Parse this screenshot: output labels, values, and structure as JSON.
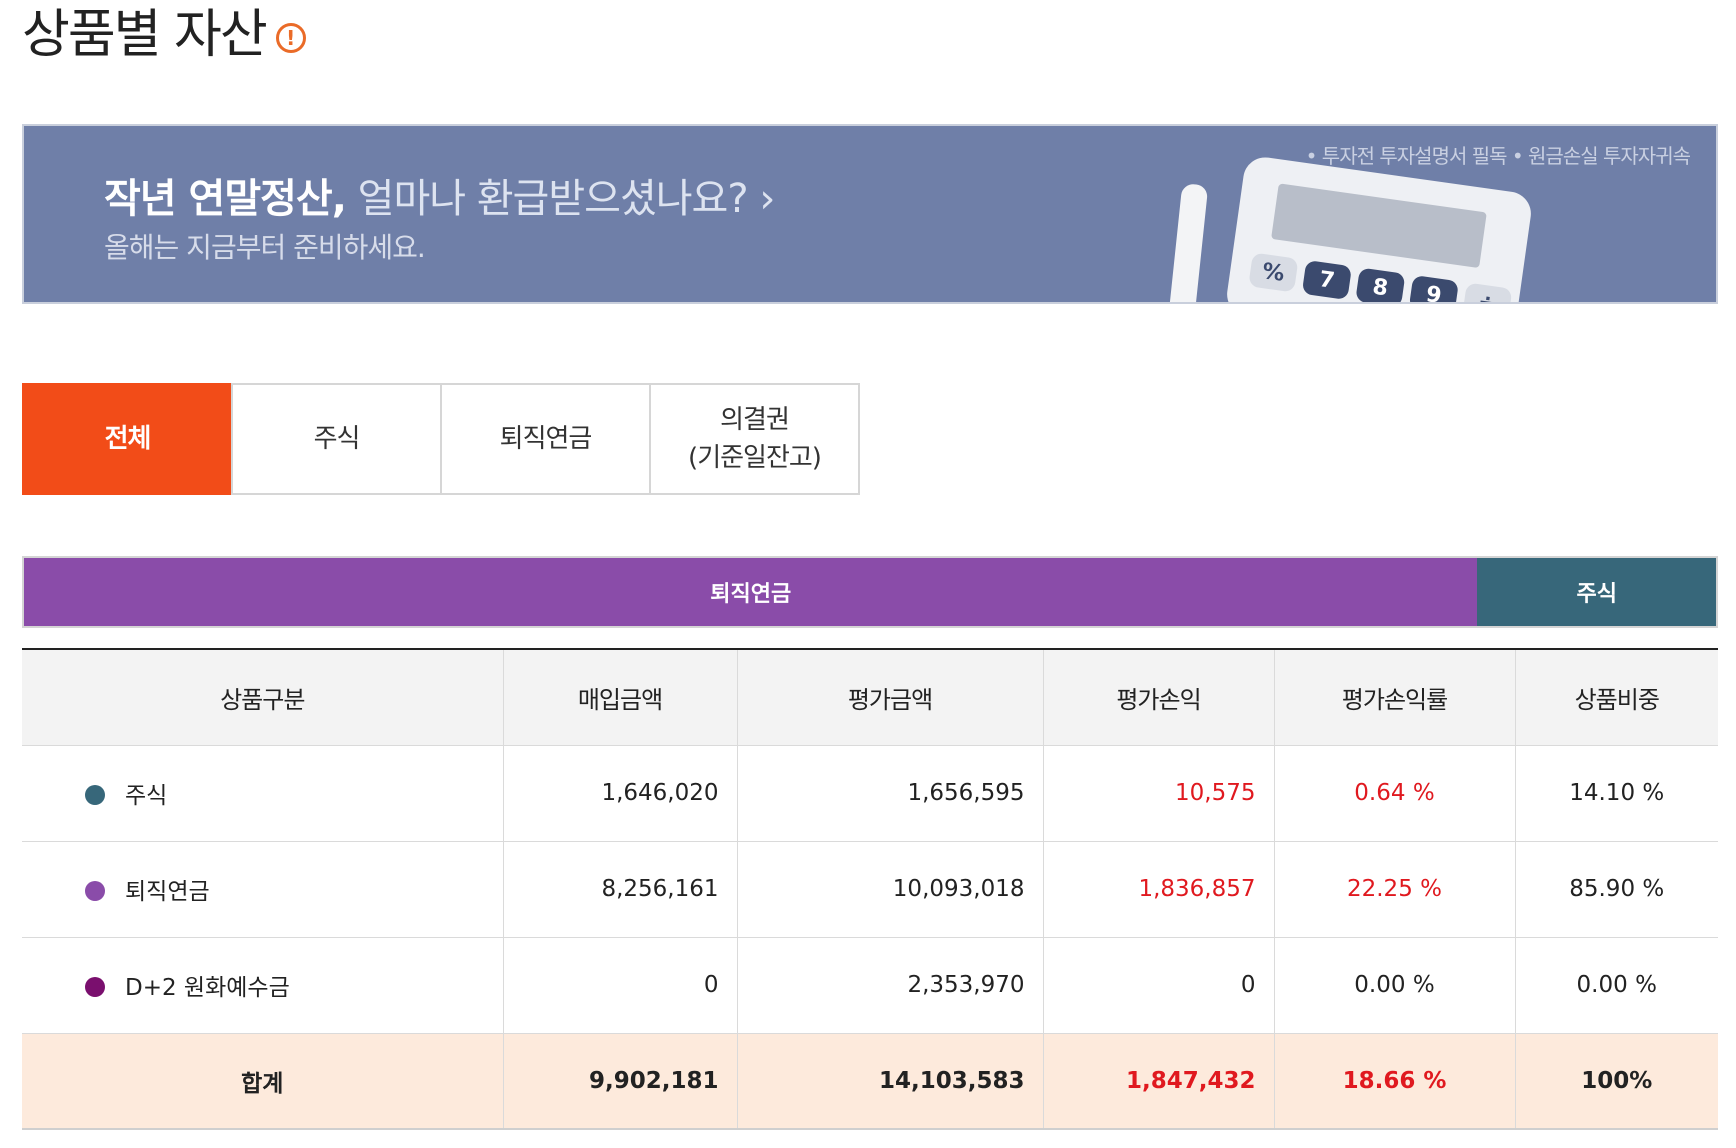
{
  "page": {
    "title": "상품별 자산",
    "info_icon": "alert-circle-icon",
    "accent_color": "#f24c18"
  },
  "banner": {
    "headline_strong": "작년 연말정산,",
    "headline_light": "얼마나 환급받으셨나요?",
    "arrow": "›",
    "subtext": "올해는 지금부터 준비하세요.",
    "disclaimer": "• 투자전 투자설명서 필독 • 원금손실 투자자귀속",
    "calculator_keys": [
      "%",
      "7",
      "8",
      "9",
      "÷"
    ]
  },
  "tabs": [
    {
      "label": "전체",
      "active": true
    },
    {
      "label": "주식",
      "active": false
    },
    {
      "label": "퇴직연금",
      "active": false
    },
    {
      "label": "의결권\n(기준일잔고)",
      "active": false
    }
  ],
  "allocation_bar": [
    {
      "label": "퇴직연금",
      "share": 85.9,
      "color": "#8a4ca9"
    },
    {
      "label": "주식",
      "share": 14.1,
      "color": "#37677a"
    }
  ],
  "table": {
    "headers": [
      "상품구분",
      "매입금액",
      "평가금액",
      "평가손익",
      "평가손익률",
      "상품비중"
    ],
    "rows": [
      {
        "name": "주식",
        "dot_color": "#37677a",
        "purchase": "1,646,020",
        "valuation": "1,656,595",
        "pnl": "10,575",
        "pnl_rate": "0.64 %",
        "weight": "14.10 %",
        "positive": true
      },
      {
        "name": "퇴직연금",
        "dot_color": "#8a4ca9",
        "purchase": "8,256,161",
        "valuation": "10,093,018",
        "pnl": "1,836,857",
        "pnl_rate": "22.25 %",
        "weight": "85.90 %",
        "positive": true
      },
      {
        "name": "D+2 원화예수금",
        "dot_color": "#7a0f6e",
        "purchase": "0",
        "valuation": "2,353,970",
        "pnl": "0",
        "pnl_rate": "0.00 %",
        "weight": "0.00 %",
        "positive": false
      }
    ],
    "total": {
      "name": "합계",
      "purchase": "9,902,181",
      "valuation": "14,103,583",
      "pnl": "1,847,432",
      "pnl_rate": "18.66 %",
      "weight": "100%"
    }
  }
}
